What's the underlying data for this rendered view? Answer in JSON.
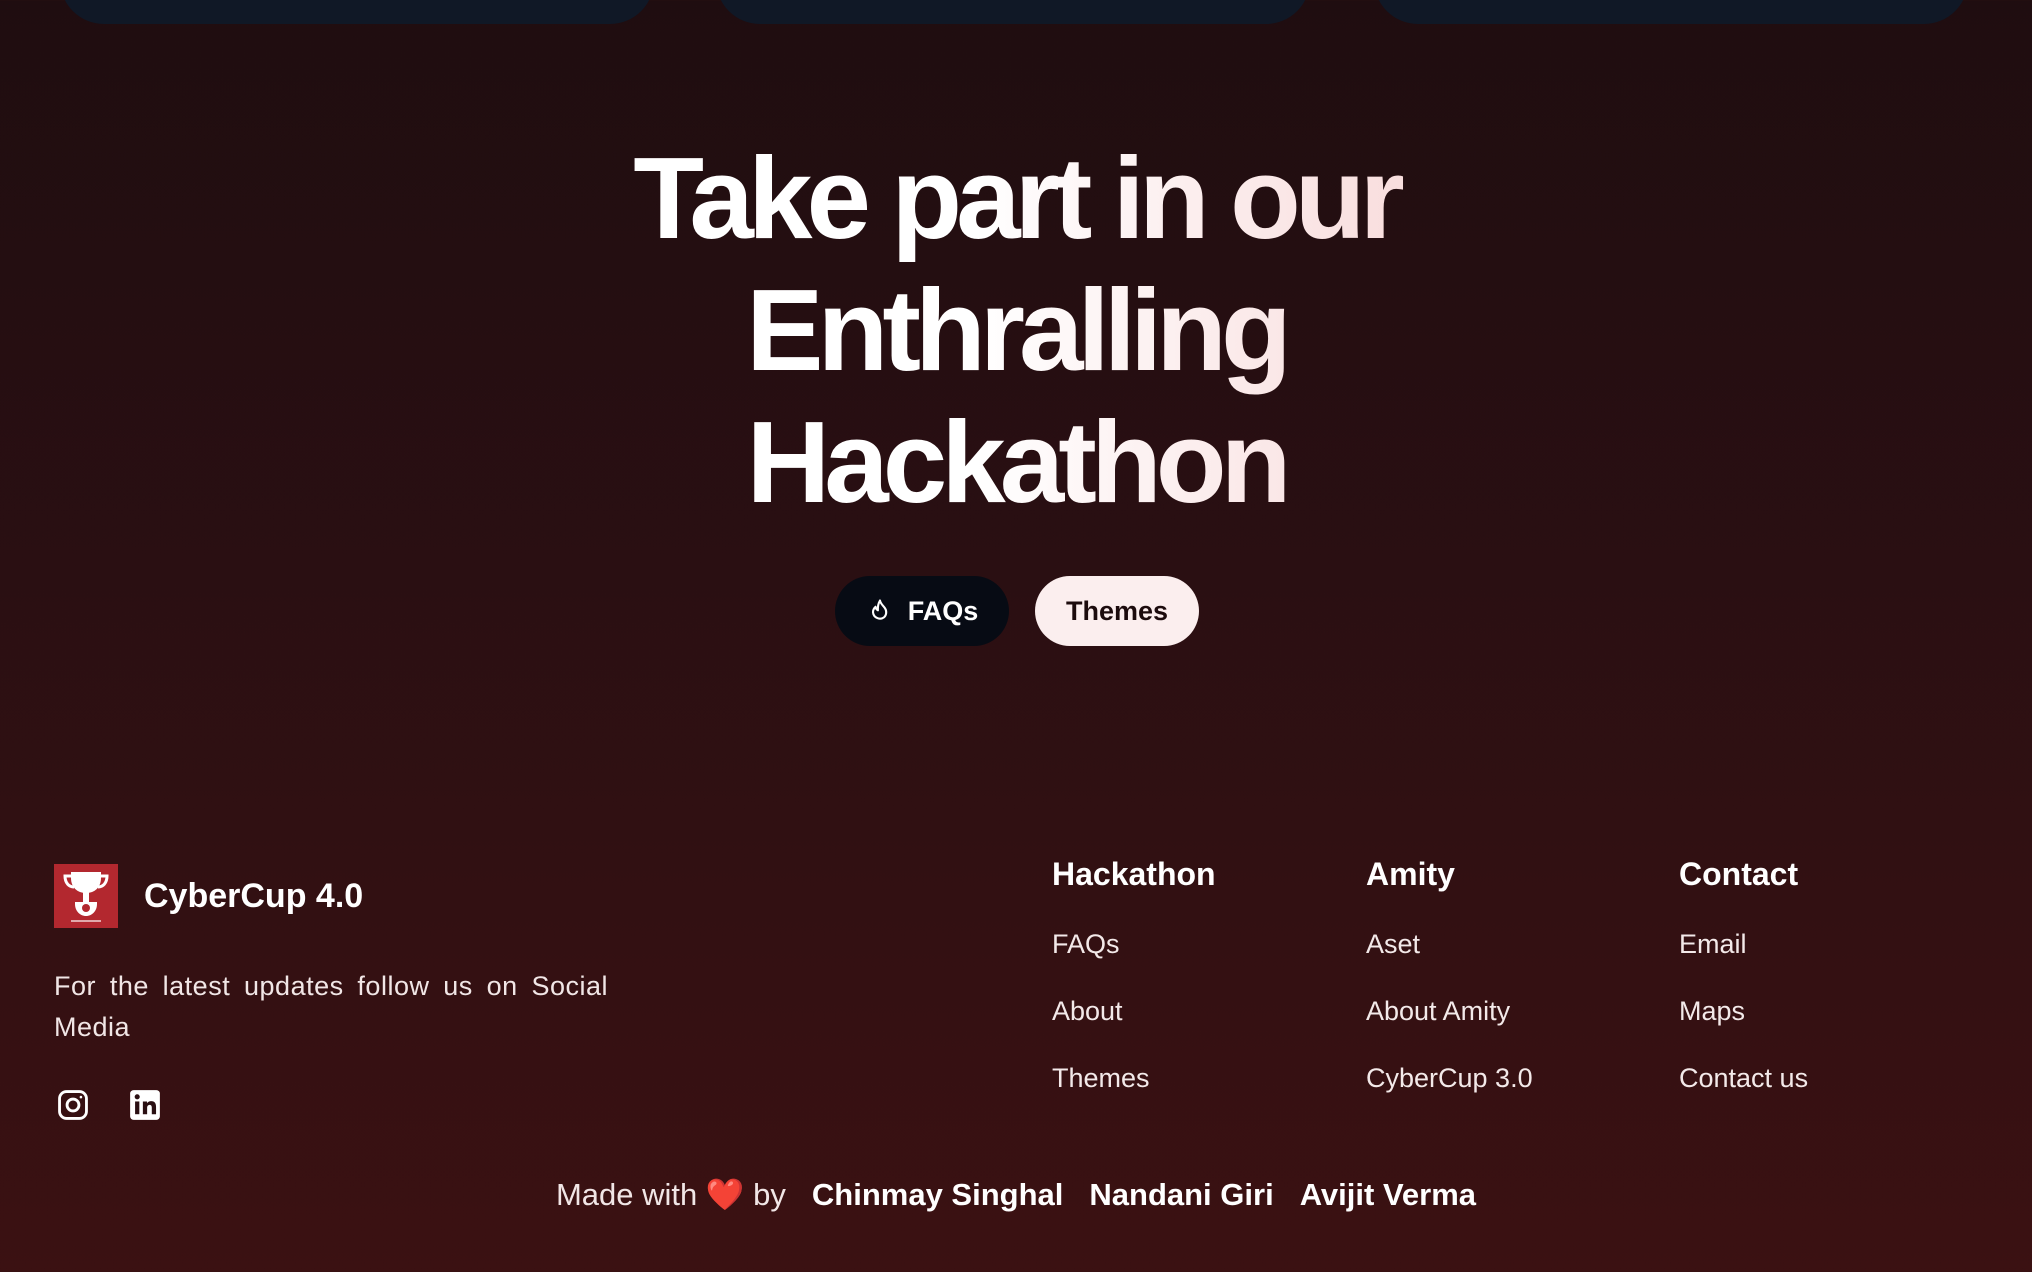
{
  "hero": {
    "words": [
      "Take",
      "part",
      "in",
      "our",
      "Enthralling",
      "Hackathon"
    ],
    "buttons": {
      "faqs_label": "FAQs",
      "faqs_icon": "flame-icon",
      "themes_label": "Themes"
    }
  },
  "footer": {
    "brand": {
      "name": "CyberCup 4.0",
      "logo_icon": "trophy-icon",
      "tagline": "For the latest updates follow us on Social Media"
    },
    "socials": [
      {
        "icon": "instagram-icon"
      },
      {
        "icon": "linkedin-icon"
      }
    ],
    "columns": [
      {
        "title": "Hackathon",
        "links": [
          "FAQs",
          "About",
          "Themes"
        ]
      },
      {
        "title": "Amity",
        "links": [
          "Aset",
          "About Amity",
          "CyberCup 3.0"
        ]
      },
      {
        "title": "Contact",
        "links": [
          "Email",
          "Maps",
          "Contact us"
        ]
      }
    ],
    "credits": {
      "made_with": "Made with",
      "heart": "❤️",
      "by": "by",
      "authors": [
        "Chinmay Singhal",
        "Nandani Giri",
        "Avijit Verma"
      ]
    }
  },
  "colors": {
    "background_top": "#1f0d10",
    "background_bottom": "#3b1112",
    "faqs_button_bg": "#070b14",
    "themes_button_bg": "#fbeeee",
    "logo_bg": "#b3282f",
    "top_card_bg": "#101826"
  }
}
